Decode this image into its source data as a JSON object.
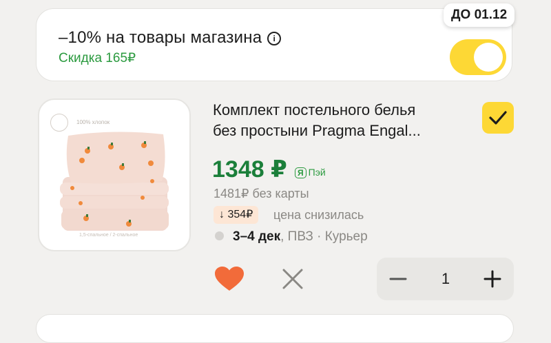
{
  "promo": {
    "title": "–10% на товары магазина",
    "discount": "Скидка 165₽",
    "deadline": "ДО 01.12",
    "toggle_on": true
  },
  "product": {
    "image_caption_top": "100% хлопок",
    "image_caption_bottom": "1,5-спальное / 2-спальное",
    "title_line1": "Комплект постельного белья",
    "title_line2": "без простыни Pragma Engal...",
    "checked": true,
    "price": "1348 ₽",
    "pay_badge": "Я",
    "pay_label": "Пэй",
    "price_without_card": "1481₽ без карты",
    "price_drop": "↓ 354₽",
    "price_drop_text": "цена снизилась",
    "delivery_date": "3–4 дек",
    "delivery_rest": ", ПВЗ · Курьер",
    "quantity": "1"
  },
  "colors": {
    "yellow": "#fdd835",
    "green": "#1b7f3a",
    "heart": "#f26b3a"
  }
}
